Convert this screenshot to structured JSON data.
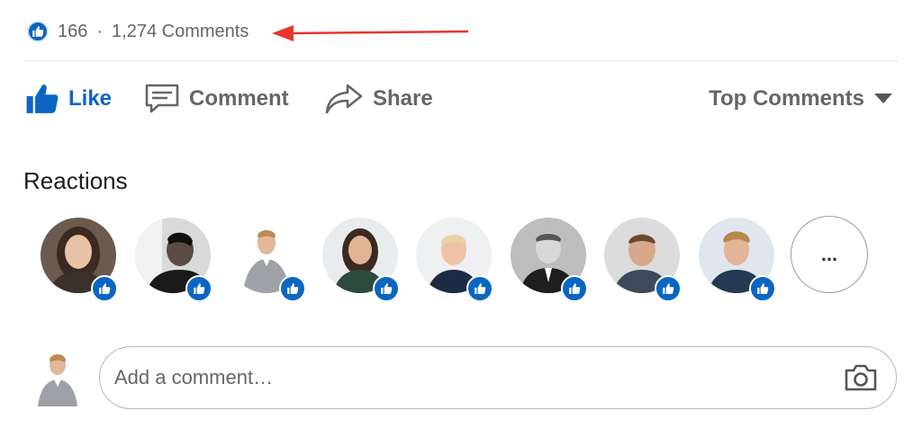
{
  "social_counts": {
    "reactions_count": "166",
    "separator": "·",
    "comments_count": "1,274 Comments"
  },
  "actions": {
    "like_label": "Like",
    "comment_label": "Comment",
    "share_label": "Share",
    "sort_label": "Top Comments"
  },
  "reactions": {
    "title": "Reactions",
    "more_label": "...",
    "avatars": [
      {
        "icon": "person-avatar",
        "reaction": "like-icon"
      },
      {
        "icon": "person-avatar",
        "reaction": "like-icon"
      },
      {
        "icon": "person-avatar",
        "reaction": "like-icon"
      },
      {
        "icon": "person-avatar",
        "reaction": "like-icon"
      },
      {
        "icon": "person-avatar",
        "reaction": "like-icon"
      },
      {
        "icon": "person-avatar",
        "reaction": "like-icon"
      },
      {
        "icon": "person-avatar",
        "reaction": "like-icon"
      },
      {
        "icon": "person-avatar",
        "reaction": "like-icon"
      }
    ]
  },
  "comment_box": {
    "placeholder": "Add a comment…"
  },
  "colors": {
    "brand_blue": "#0a66c2",
    "annotation_red": "#e8342c",
    "text_gray": "#666666"
  }
}
